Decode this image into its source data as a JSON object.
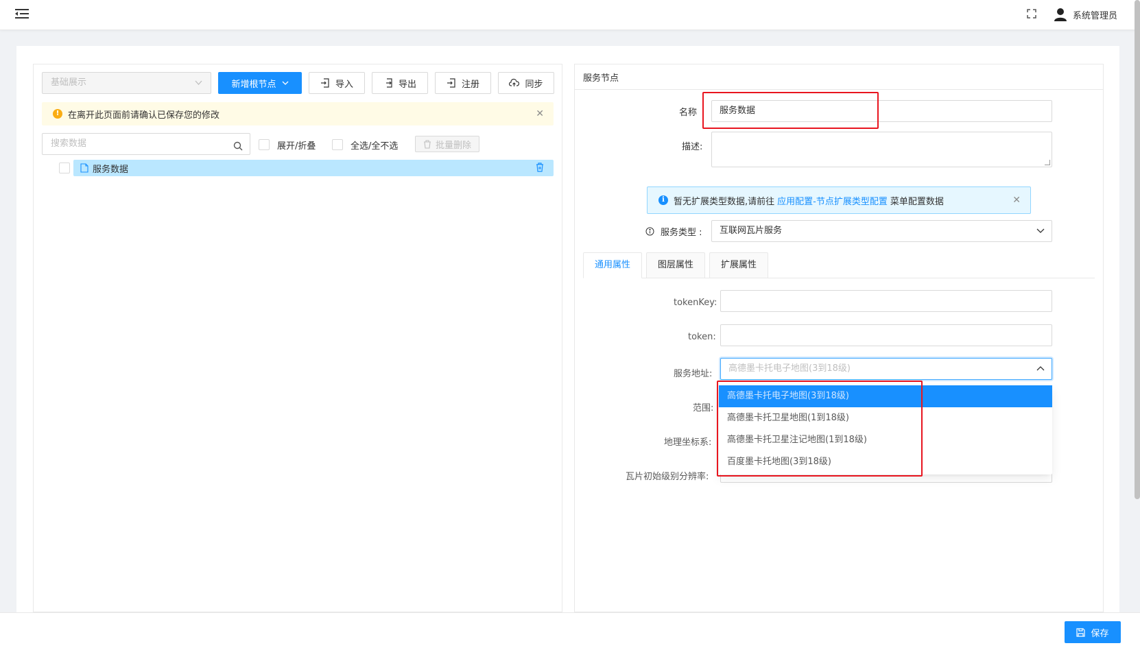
{
  "header": {
    "user_name": "系统管理员"
  },
  "left": {
    "selector_value": "基础展示",
    "buttons": {
      "add_root": "新增根节点",
      "import": "导入",
      "export": "导出",
      "register": "注册",
      "sync": "同步"
    },
    "warning_text": "在离开此页面前请确认已保存您的修改",
    "search_placeholder": "搜索数据",
    "expand_collapse": "展开/折叠",
    "select_all": "全选/全不选",
    "batch_delete": "批量删除",
    "tree_items": [
      {
        "label": "服务数据"
      }
    ]
  },
  "right": {
    "title": "服务节点",
    "name_label": "名称",
    "name_value": "服务数据",
    "desc_label": "描述:",
    "info": {
      "prefix": "暂无扩展类型数据,请前往",
      "link": "应用配置-节点扩展类型配置",
      "suffix": "菜单配置数据"
    },
    "service_type_label": "服务类型 :",
    "service_type_value": "互联网瓦片服务",
    "tabs": [
      "通用属性",
      "图层属性",
      "扩展属性"
    ],
    "fields": {
      "token_key": "tokenKey:",
      "token": "token:",
      "service_url": "服务地址:",
      "range": "范围:",
      "geo_crs": "地理坐标系:",
      "tile_res": "瓦片初始级别分辨率:"
    },
    "service_url_placeholder": "高德墨卡托电子地图(3到18级)",
    "dropdown_options": [
      "高德墨卡托电子地图(3到18级)",
      "高德墨卡托卫星地图(1到18级)",
      "高德墨卡托卫星注记地图(1到18级)",
      "百度墨卡托地图(3到18级)"
    ]
  },
  "footer": {
    "save": "保存"
  },
  "colors": {
    "primary": "#1890ff",
    "highlight_box": "#e8141e",
    "warning": "#faad14",
    "tree_selected": "#bae7ff"
  }
}
